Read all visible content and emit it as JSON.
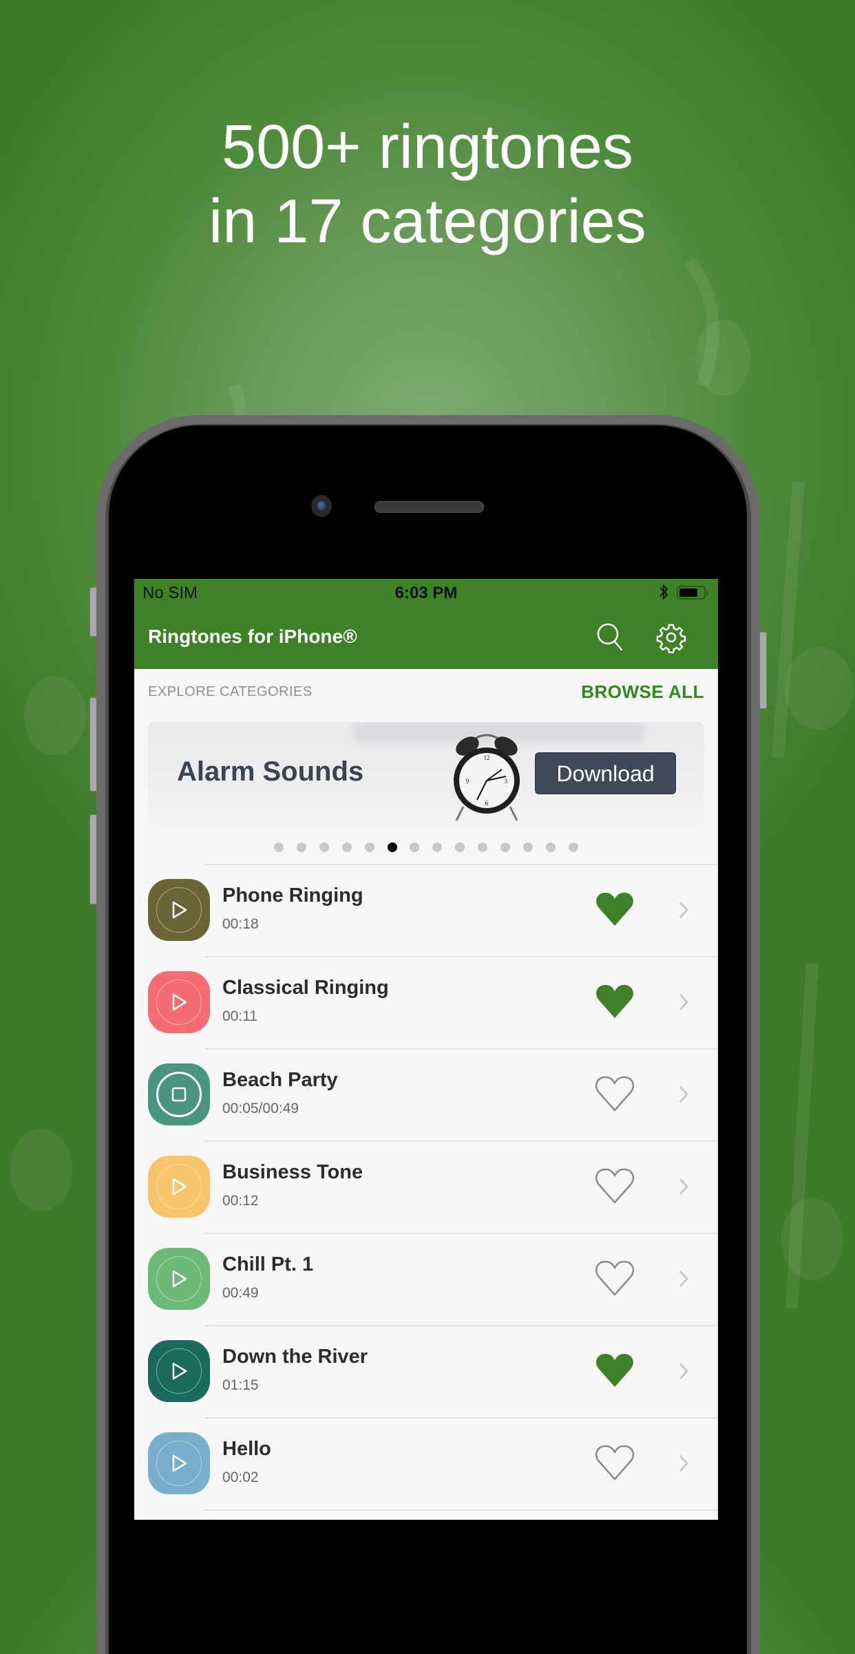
{
  "headline": {
    "line1": "500+ ringtones",
    "line2": "in 17 categories"
  },
  "status_bar": {
    "carrier": "No SIM",
    "time": "6:03 PM",
    "bluetooth_icon": "bluetooth-icon",
    "battery_icon": "battery-icon"
  },
  "nav": {
    "title": "Ringtones for iPhone®",
    "search_icon": "search-icon",
    "settings_icon": "gear-icon",
    "color": "#3f8126"
  },
  "section": {
    "label": "EXPLORE CATEGORIES",
    "browse_all": "BROWSE ALL",
    "browse_color": "#2f8a1a"
  },
  "banner": {
    "title": "Alarm Sounds",
    "button": "Download",
    "page_count": 14,
    "active_page": 6
  },
  "ringtones": [
    {
      "title": "Phone Ringing",
      "duration": "00:18",
      "color": "#6b6436",
      "state": "play",
      "favorite": true
    },
    {
      "title": "Classical Ringing",
      "duration": "00:11",
      "color": "#f46b72",
      "state": "play",
      "favorite": true
    },
    {
      "title": "Beach Party",
      "duration": "00:05/00:49",
      "color": "#4a9582",
      "state": "stop",
      "favorite": false
    },
    {
      "title": "Business Tone",
      "duration": "00:12",
      "color": "#f7c56c",
      "state": "play",
      "favorite": false
    },
    {
      "title": "Chill Pt. 1",
      "duration": "00:49",
      "color": "#6db978",
      "state": "play",
      "favorite": false
    },
    {
      "title": "Down the River",
      "duration": "01:15",
      "color": "#1b6a5c",
      "state": "play",
      "favorite": true
    },
    {
      "title": "Hello",
      "duration": "00:02",
      "color": "#78aecb",
      "state": "play",
      "favorite": false
    },
    {
      "title": "",
      "duration": "",
      "color": "#8b1530",
      "state": "play",
      "favorite": false
    }
  ],
  "colors": {
    "favorite": "#3f8126",
    "heart_outline": "#8a8a8a",
    "chevron": "#c7c7cc"
  }
}
